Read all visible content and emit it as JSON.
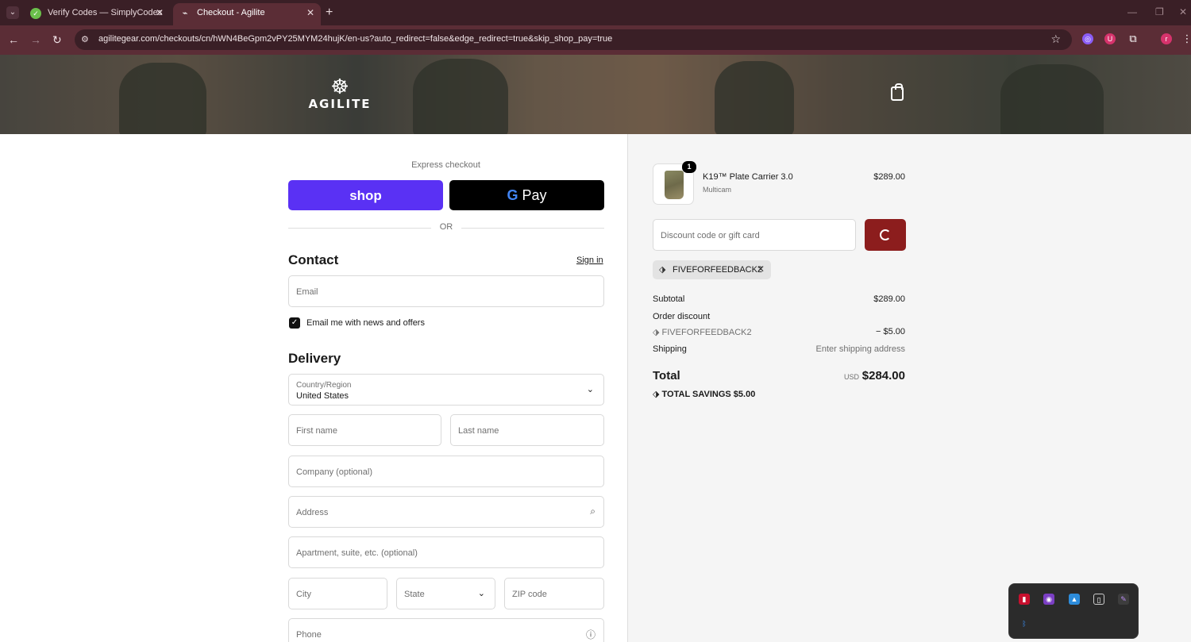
{
  "browser": {
    "tabs": [
      {
        "title": "Verify Codes — SimplyCodes",
        "active": false
      },
      {
        "title": "Checkout - Agilite",
        "active": true
      }
    ],
    "url": "agilitegear.com/checkouts/cn/hWN4BeGpm2vPY25MYM24hujK/en-us?auto_redirect=false&edge_redirect=true&skip_shop_pay=true",
    "profile_initial": "r"
  },
  "brand": {
    "name": "AGILITE"
  },
  "express": {
    "label": "Express checkout",
    "shop_label": "shop",
    "gpay_g": "G",
    "gpay_label": "Pay",
    "or_label": "OR"
  },
  "contact": {
    "title": "Contact",
    "sign_in": "Sign in",
    "email_placeholder": "Email",
    "newsletter_label": "Email me with news and offers",
    "newsletter_checked": true
  },
  "delivery": {
    "title": "Delivery",
    "country_label": "Country/Region",
    "country_value": "United States",
    "first_name": "First name",
    "last_name": "Last name",
    "company": "Company (optional)",
    "address": "Address",
    "apartment": "Apartment, suite, etc. (optional)",
    "city": "City",
    "state": "State",
    "zip": "ZIP code",
    "phone": "Phone"
  },
  "summary": {
    "item": {
      "name": "K19™ Plate Carrier 3.0",
      "variant": "Multicam",
      "price": "$289.00",
      "quantity": "1"
    },
    "discount_placeholder": "Discount code or gift card",
    "applied_code": "FIVEFORFEEDBACK2",
    "subtotal_label": "Subtotal",
    "subtotal_value": "$289.00",
    "order_discount_label": "Order discount",
    "discount_code": "FIVEFORFEEDBACK2",
    "discount_value": "− $5.00",
    "shipping_label": "Shipping",
    "shipping_value": "Enter shipping address",
    "total_label": "Total",
    "currency": "USD",
    "total_value": "$284.00",
    "savings_label": "TOTAL SAVINGS",
    "savings_value": "$5.00"
  },
  "colors": {
    "shop_pay": "#5a31f4",
    "apply_button": "#8c1d1d",
    "browser_frame": "#5b2d36"
  }
}
